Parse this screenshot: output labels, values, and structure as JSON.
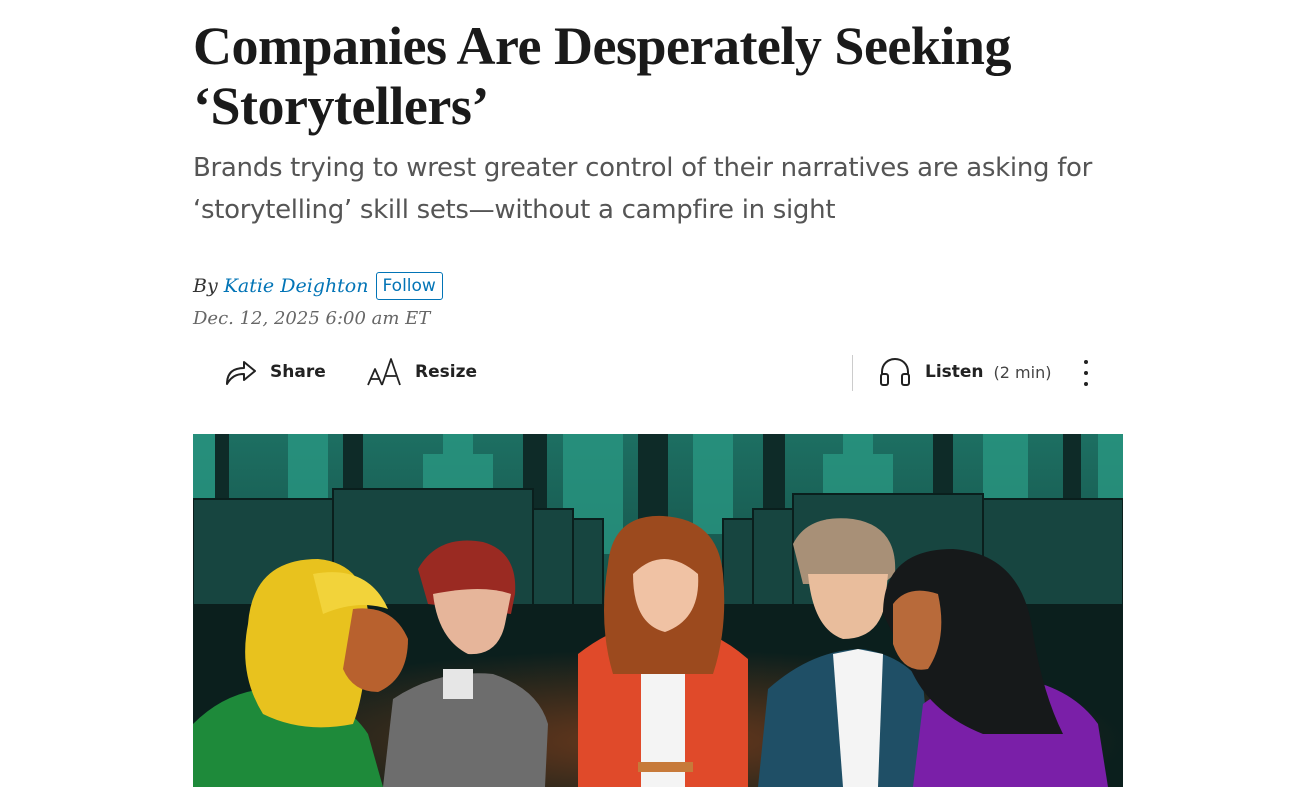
{
  "article": {
    "headline": "Companies Are Desperately Seeking ‘Storytellers’",
    "dek": "Brands trying to wrest greater control of their narratives are asking for ‘storytelling’ skill sets—without a campfire in sight",
    "byline_prefix": "By",
    "author": "Katie Deighton",
    "follow_label": "Follow",
    "timestamp": "Dec. 12, 2025 6:00 am ET"
  },
  "toolbar": {
    "share_label": "Share",
    "share_icon": "share-arrow-icon",
    "resize_label": "Resize",
    "resize_icon": "text-resize-icon",
    "listen_label": "Listen",
    "listen_duration": "(2 min)",
    "listen_icon": "headphones-icon",
    "more_icon": "vertical-ellipsis-icon"
  },
  "colors": {
    "link": "#0274b6",
    "headline": "#1a1a1a",
    "dek": "#555555",
    "illustration_bg": "#0f3a36"
  }
}
